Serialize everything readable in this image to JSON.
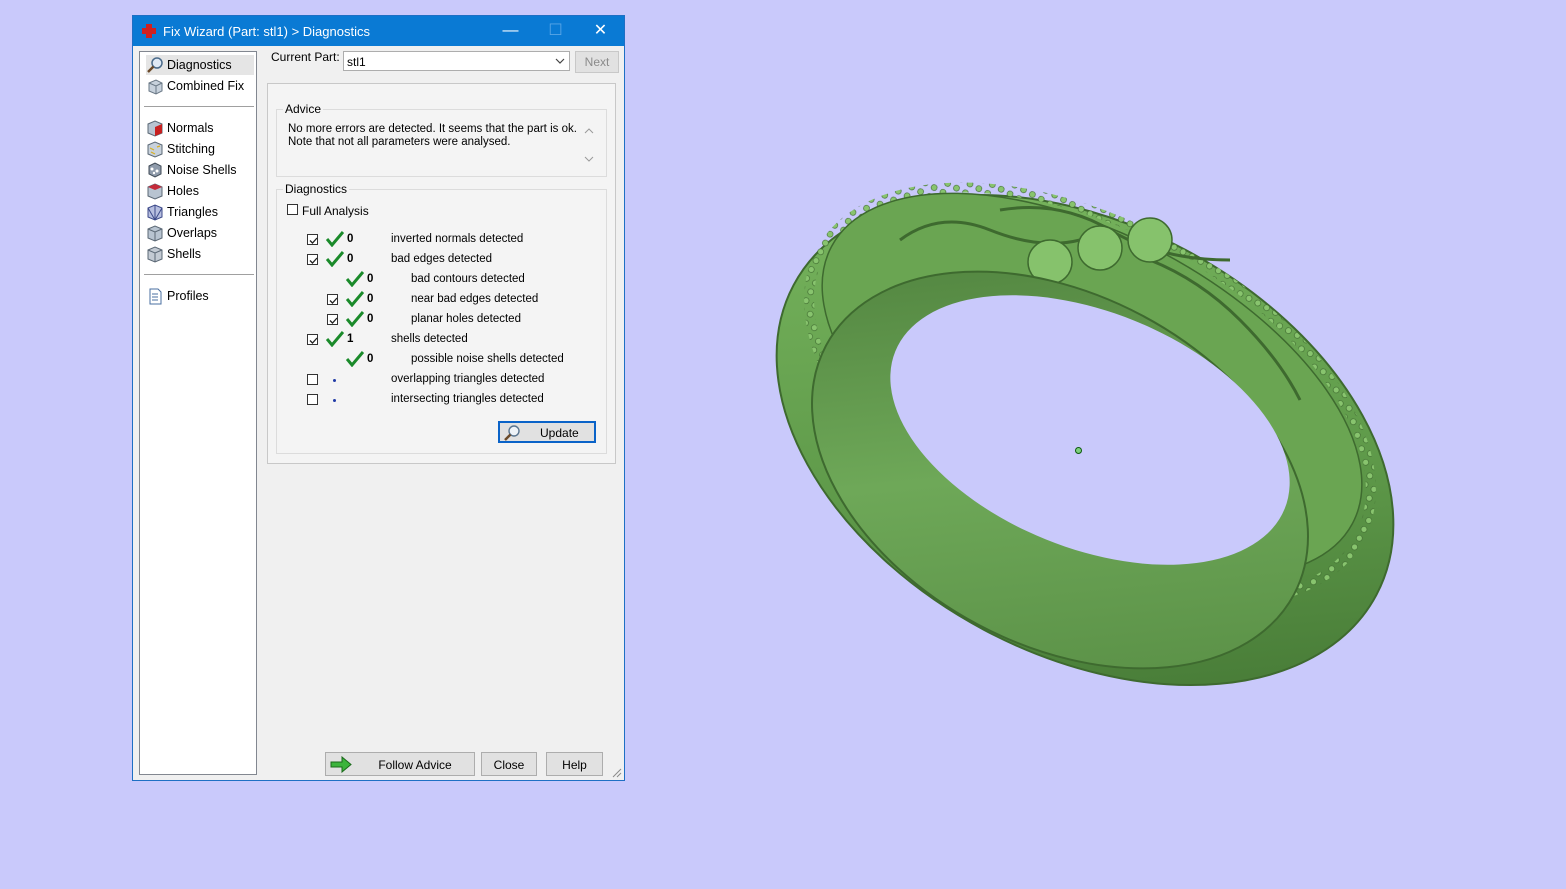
{
  "window": {
    "title": "Fix Wizard (Part: stl1) > Diagnostics",
    "controls": {
      "minimize": "—",
      "maximize": "☐",
      "close": "✕"
    }
  },
  "nav": {
    "top_items": [
      {
        "label": "Diagnostics",
        "icon": "magnifier-icon",
        "selected": true
      },
      {
        "label": "Combined Fix",
        "icon": "cube-icon",
        "selected": false
      }
    ],
    "fix_items": [
      {
        "label": "Normals",
        "icon": "normals-cube-icon"
      },
      {
        "label": "Stitching",
        "icon": "stitching-cube-icon"
      },
      {
        "label": "Noise Shells",
        "icon": "noise-shells-icon"
      },
      {
        "label": "Holes",
        "icon": "holes-cube-icon"
      },
      {
        "label": "Triangles",
        "icon": "triangles-cube-icon"
      },
      {
        "label": "Overlaps",
        "icon": "overlaps-cube-icon"
      },
      {
        "label": "Shells",
        "icon": "shells-cube-icon"
      }
    ],
    "profiles": {
      "label": "Profiles",
      "icon": "document-icon"
    }
  },
  "current_part": {
    "label": "Current Part:",
    "value": "stl1",
    "next_label": "Next"
  },
  "advice": {
    "title": "Advice",
    "line1": "No more errors are detected. It seems that the part is ok.",
    "line2": "Note that not all parameters were analysed."
  },
  "diagnostics": {
    "title": "Diagnostics",
    "full_analysis_label": "Full Analysis",
    "full_analysis_checked": false,
    "rows": [
      {
        "checked": true,
        "status": "ok",
        "count": "0",
        "label": "inverted normals detected",
        "indent": 0
      },
      {
        "checked": true,
        "status": "ok",
        "count": "0",
        "label": "bad edges detected",
        "indent": 0
      },
      {
        "checked": null,
        "status": "ok",
        "count": "0",
        "label": "bad contours detected",
        "indent": 1
      },
      {
        "checked": true,
        "status": "ok",
        "count": "0",
        "label": "near bad edges detected",
        "indent": 1
      },
      {
        "checked": true,
        "status": "ok",
        "count": "0",
        "label": "planar holes detected",
        "indent": 1
      },
      {
        "checked": true,
        "status": "ok",
        "count": "1",
        "label": "shells detected",
        "indent": 0
      },
      {
        "checked": null,
        "status": "ok",
        "count": "0",
        "label": "possible noise shells detected",
        "indent": 1
      },
      {
        "checked": false,
        "status": "pending",
        "count": "",
        "label": "overlapping triangles detected",
        "indent": 0
      },
      {
        "checked": false,
        "status": "pending",
        "count": "",
        "label": "intersecting triangles detected",
        "indent": 0
      }
    ],
    "update_label": "Update"
  },
  "buttons": {
    "follow_advice": "Follow Advice",
    "close": "Close",
    "help": "Help"
  },
  "colors": {
    "background": "#c9c9fb",
    "titlebar": "#0a7ad4",
    "ring_green": "#5f9a4a",
    "check_green": "#1a8a2a"
  }
}
